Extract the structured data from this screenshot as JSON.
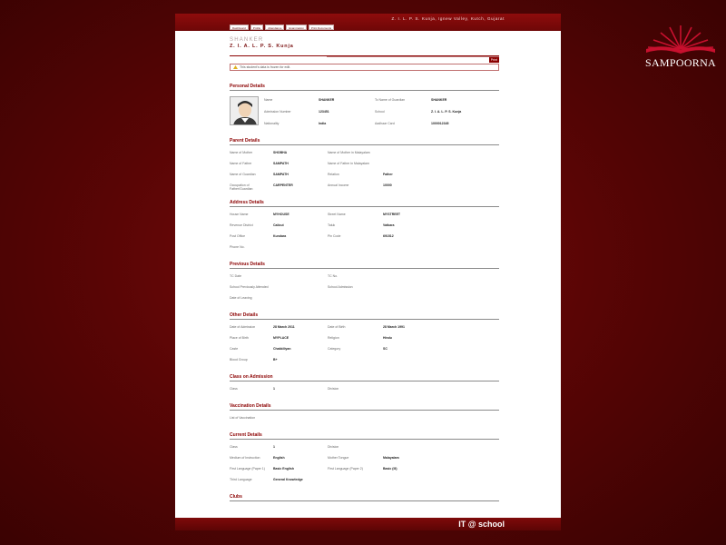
{
  "brand": {
    "logo_text": "SAMPOORNA",
    "footer": "IT @ school",
    "accent": "#8b0000"
  },
  "school_title": "Z. I. L. P. S. Kunja, Ignew Valley, Kutch, Gujarat",
  "tabs": [
    "Dashboard",
    "Profile",
    "Attendance",
    "Examination",
    "Print Documents"
  ],
  "student": {
    "name": "SHANKER",
    "school": "Z. I. A. L. P. S. Kunja"
  },
  "print_label": "Print",
  "notice": "This student's data is frozen for edit.",
  "personal": {
    "title": "Personal Details",
    "rows": [
      [
        "Name",
        "SHANKER",
        "Tc Name of Guardian",
        "SHANKER"
      ],
      [
        "Admission Number",
        "123451",
        "School",
        "Z. I. A. L. P. S. Kunja"
      ],
      [
        "Nationality",
        "India",
        "Aadhaar Card",
        "1000012345"
      ]
    ]
  },
  "parent": {
    "title": "Parent Details",
    "rows": [
      [
        "Name of Mother",
        "SHOBHA",
        "Name of Mother in Malayalam",
        ""
      ],
      [
        "Name of Father",
        "SAMPATH",
        "Name of Father in Malayalam",
        ""
      ],
      [
        "Name of Guardian",
        "SAMPATH",
        "Relation",
        "Father"
      ],
      [
        "Occupation of Father/Guardian",
        "CARPENTER",
        "Annual Income",
        "10000"
      ]
    ]
  },
  "address": {
    "title": "Address Details",
    "rows": [
      [
        "House Name",
        "MYHOUSE",
        "Street Name",
        "MYSTREET"
      ],
      [
        "Revenue District",
        "Calicut",
        "Taluk",
        "Vatkara"
      ],
      [
        "Post Office",
        "Kundara",
        "Pin Code",
        "691512"
      ],
      [
        "Phone No.",
        "",
        "",
        ""
      ]
    ]
  },
  "previous": {
    "title": "Previous Details",
    "rows": [
      [
        "TC Date",
        "",
        "TC No.",
        ""
      ],
      [
        "School Previously Attended",
        "",
        "School Admission",
        ""
      ],
      [
        "Date of Leaving",
        "",
        "",
        ""
      ]
    ]
  },
  "other": {
    "title": "Other Details",
    "rows": [
      [
        "Date of Admission",
        "28 March 2011",
        "Date of Birth",
        "28 March 1991"
      ],
      [
        "Place of Birth",
        "MYPLACE",
        "Religion",
        "Hindu"
      ],
      [
        "Caste",
        "Chakkiliyan",
        "Category",
        "SC"
      ],
      [
        "Blood Group",
        "B+",
        "",
        ""
      ]
    ]
  },
  "class_admission": {
    "title": "Class on Admission",
    "rows": [
      [
        "Class",
        "1",
        "Division",
        ""
      ]
    ]
  },
  "vaccination": {
    "title": "Vaccination Details",
    "rows": [
      [
        "List of Vaccination",
        "",
        "",
        ""
      ]
    ]
  },
  "current": {
    "title": "Current Details",
    "rows": [
      [
        "Class",
        "1",
        "Division",
        ""
      ],
      [
        "Medium of Instruction",
        "English",
        "Mother Tongue",
        "Malayalam"
      ],
      [
        "First Language (Paper 1)",
        "Basic English",
        "First Language (Paper 2)",
        "Basic (Ill)"
      ],
      [
        "Third Language",
        "General Knowledge",
        "",
        ""
      ]
    ]
  },
  "clubs": {
    "title": "Clubs"
  }
}
